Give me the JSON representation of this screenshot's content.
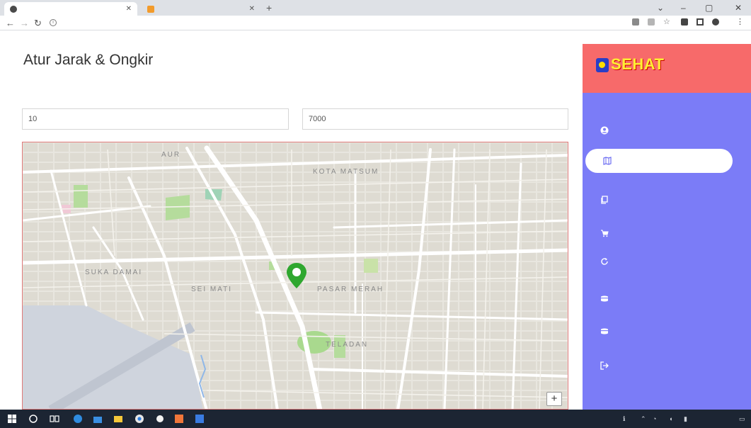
{
  "browser": {
    "tabs": [
      {
        "title": "",
        "active": true
      },
      {
        "title": "",
        "active": false
      }
    ],
    "url": ""
  },
  "page": {
    "title": "Atur Jarak & Ongkir",
    "fields": {
      "max_distance": {
        "label": "",
        "value": "10"
      },
      "price_per_km": {
        "label": "",
        "value": "7000"
      }
    },
    "map_label": ""
  },
  "map": {
    "district_labels": [
      "AUR",
      "KOTA MATSUM",
      "SUKA DAMAI",
      "SEI MATI",
      "PASAR MERAH",
      "TELADAN"
    ],
    "street_labels": [],
    "zoom_in_label": "+",
    "marker_color": "#2fa72f"
  },
  "sidebar": {
    "logo_text": "SEHAT",
    "items": [
      {
        "label": "",
        "icon": "user-circle-icon",
        "active": false
      },
      {
        "label": "",
        "icon": "map-icon",
        "active": true
      },
      {
        "label": "",
        "icon": "copy-icon",
        "active": false
      },
      {
        "label": "",
        "icon": "cart-icon",
        "active": false
      },
      {
        "label": "",
        "icon": "refresh-icon",
        "active": false
      },
      {
        "label": "",
        "icon": "box-icon",
        "active": false
      },
      {
        "label": "",
        "icon": "box-icon",
        "active": false
      },
      {
        "label": "",
        "icon": "logout-icon",
        "active": false
      }
    ]
  },
  "taskbar": {
    "time": "",
    "date": ""
  },
  "colors": {
    "sidebar": "#7b7cf7",
    "logo_bg": "#f76a6a",
    "map_border": "#e07a7a",
    "taskbar": "#1c2533"
  }
}
